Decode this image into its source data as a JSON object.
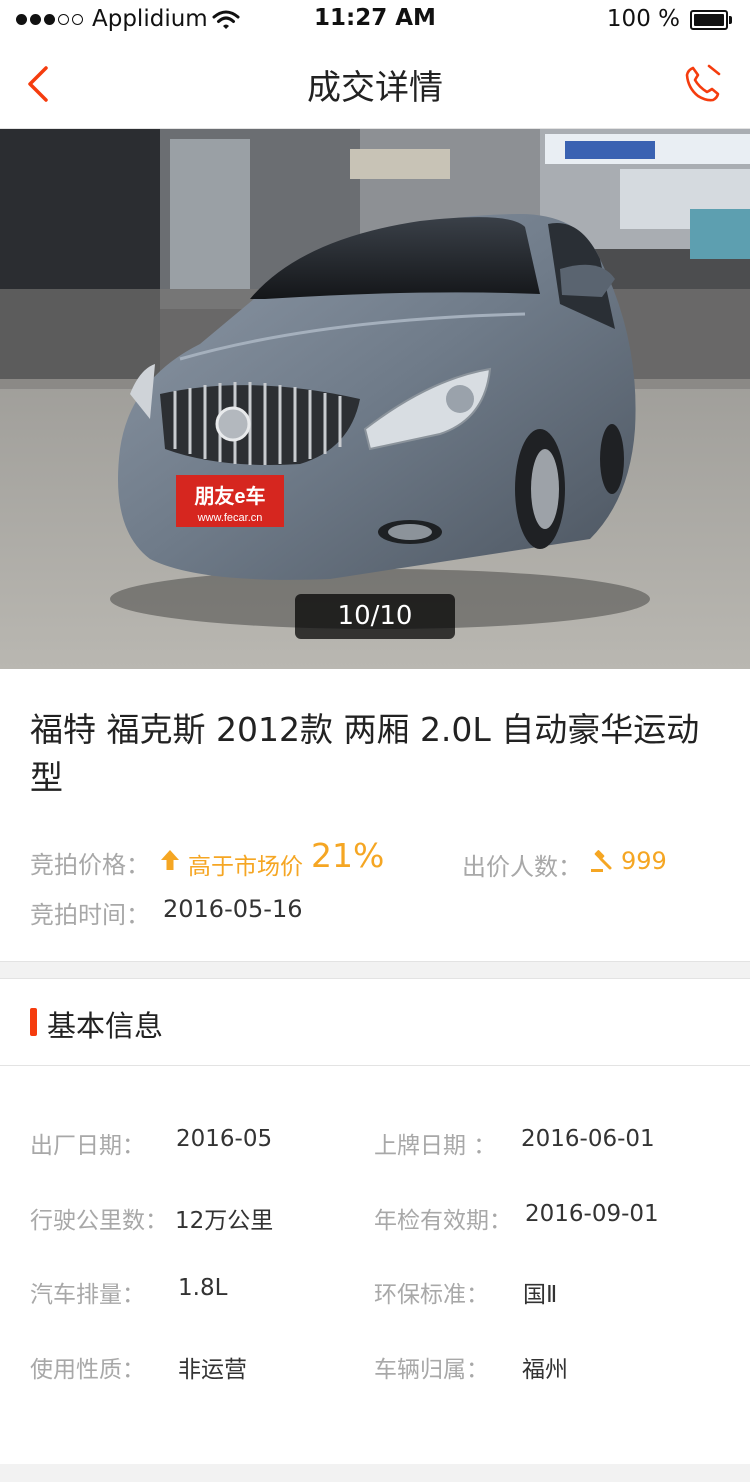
{
  "status_bar": {
    "carrier": "Applidium",
    "time": "11:27 AM",
    "battery": "100 %"
  },
  "nav": {
    "title": "成交详情",
    "back_icon": "chevron-left-icon",
    "phone_icon": "phone-icon",
    "accent_color": "#f53c0e"
  },
  "gallery": {
    "counter": "10/10",
    "plate_text": "朋友e车",
    "plate_url": "www.fecar.cn"
  },
  "car": {
    "title": "福特 福克斯 2012款 两厢 2.0L 自动豪华运动型"
  },
  "auction": {
    "price_label": "竞拍价格：",
    "price_text": "高于市场价",
    "price_percent": "21%",
    "bidders_label": "出价人数：",
    "bidders_count": "999",
    "time_label": "竞拍时间：",
    "time_value": "2016-05-16",
    "highlight_color": "#f5a623"
  },
  "basic_info": {
    "title": "基本信息",
    "items": [
      {
        "label": "出厂日期：",
        "value": "2016-05"
      },
      {
        "label": "上牌日期 ：",
        "value": "2016-06-01"
      },
      {
        "label": "行驶公里数：",
        "value": "12万公里"
      },
      {
        "label": "年检有效期：",
        "value": "2016-09-01"
      },
      {
        "label": "汽车排量：",
        "value": "1.8L"
      },
      {
        "label": "环保标准：",
        "value": "国Ⅱ"
      },
      {
        "label": "使用性质：",
        "value": "非运营"
      },
      {
        "label": "车辆归属：",
        "value": "福州"
      }
    ]
  }
}
